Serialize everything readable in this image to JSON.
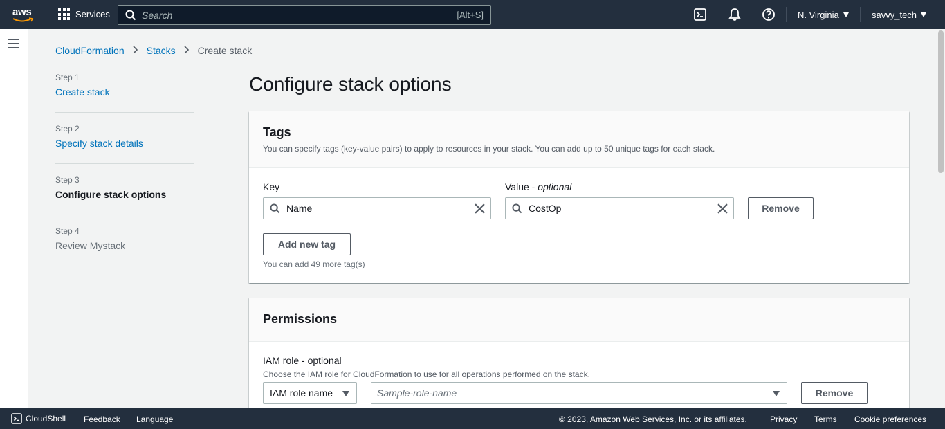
{
  "topnav": {
    "logo_text": "aws",
    "services_label": "Services",
    "search_placeholder": "Search",
    "search_shortcut": "[Alt+S]",
    "region": "N. Virginia",
    "account": "savvy_tech"
  },
  "breadcrumb": {
    "items": [
      "CloudFormation",
      "Stacks"
    ],
    "current": "Create stack"
  },
  "steps": [
    {
      "num": "Step 1",
      "label": "Create stack"
    },
    {
      "num": "Step 2",
      "label": "Specify stack details"
    },
    {
      "num": "Step 3",
      "label": "Configure stack options"
    },
    {
      "num": "Step 4",
      "label": "Review Mystack"
    }
  ],
  "page_title": "Configure stack options",
  "tags": {
    "title": "Tags",
    "description": "You can specify tags (key-value pairs) to apply to resources in your stack. You can add up to 50 unique tags for each stack.",
    "key_label": "Key",
    "value_label_prefix": "Value - ",
    "value_label_suffix": "optional",
    "key_value": "Name",
    "value_value": "CostOp",
    "remove_label": "Remove",
    "add_label": "Add new tag",
    "hint": "You can add 49 more tag(s)"
  },
  "permissions": {
    "title": "Permissions",
    "iam_label": "IAM role - optional",
    "iam_desc": "Choose the IAM role for CloudFormation to use for all operations performed on the stack.",
    "iam_type_selected": "IAM role name",
    "role_placeholder": "Sample-role-name",
    "remove_label": "Remove"
  },
  "footer": {
    "cloudshell": "CloudShell",
    "feedback": "Feedback",
    "language": "Language",
    "copyright": "© 2023, Amazon Web Services, Inc. or its affiliates.",
    "privacy": "Privacy",
    "terms": "Terms",
    "cookies": "Cookie preferences"
  },
  "colors": {
    "nav_bg": "#232f3e",
    "link": "#0073bb",
    "page_bg": "#f2f3f3"
  }
}
